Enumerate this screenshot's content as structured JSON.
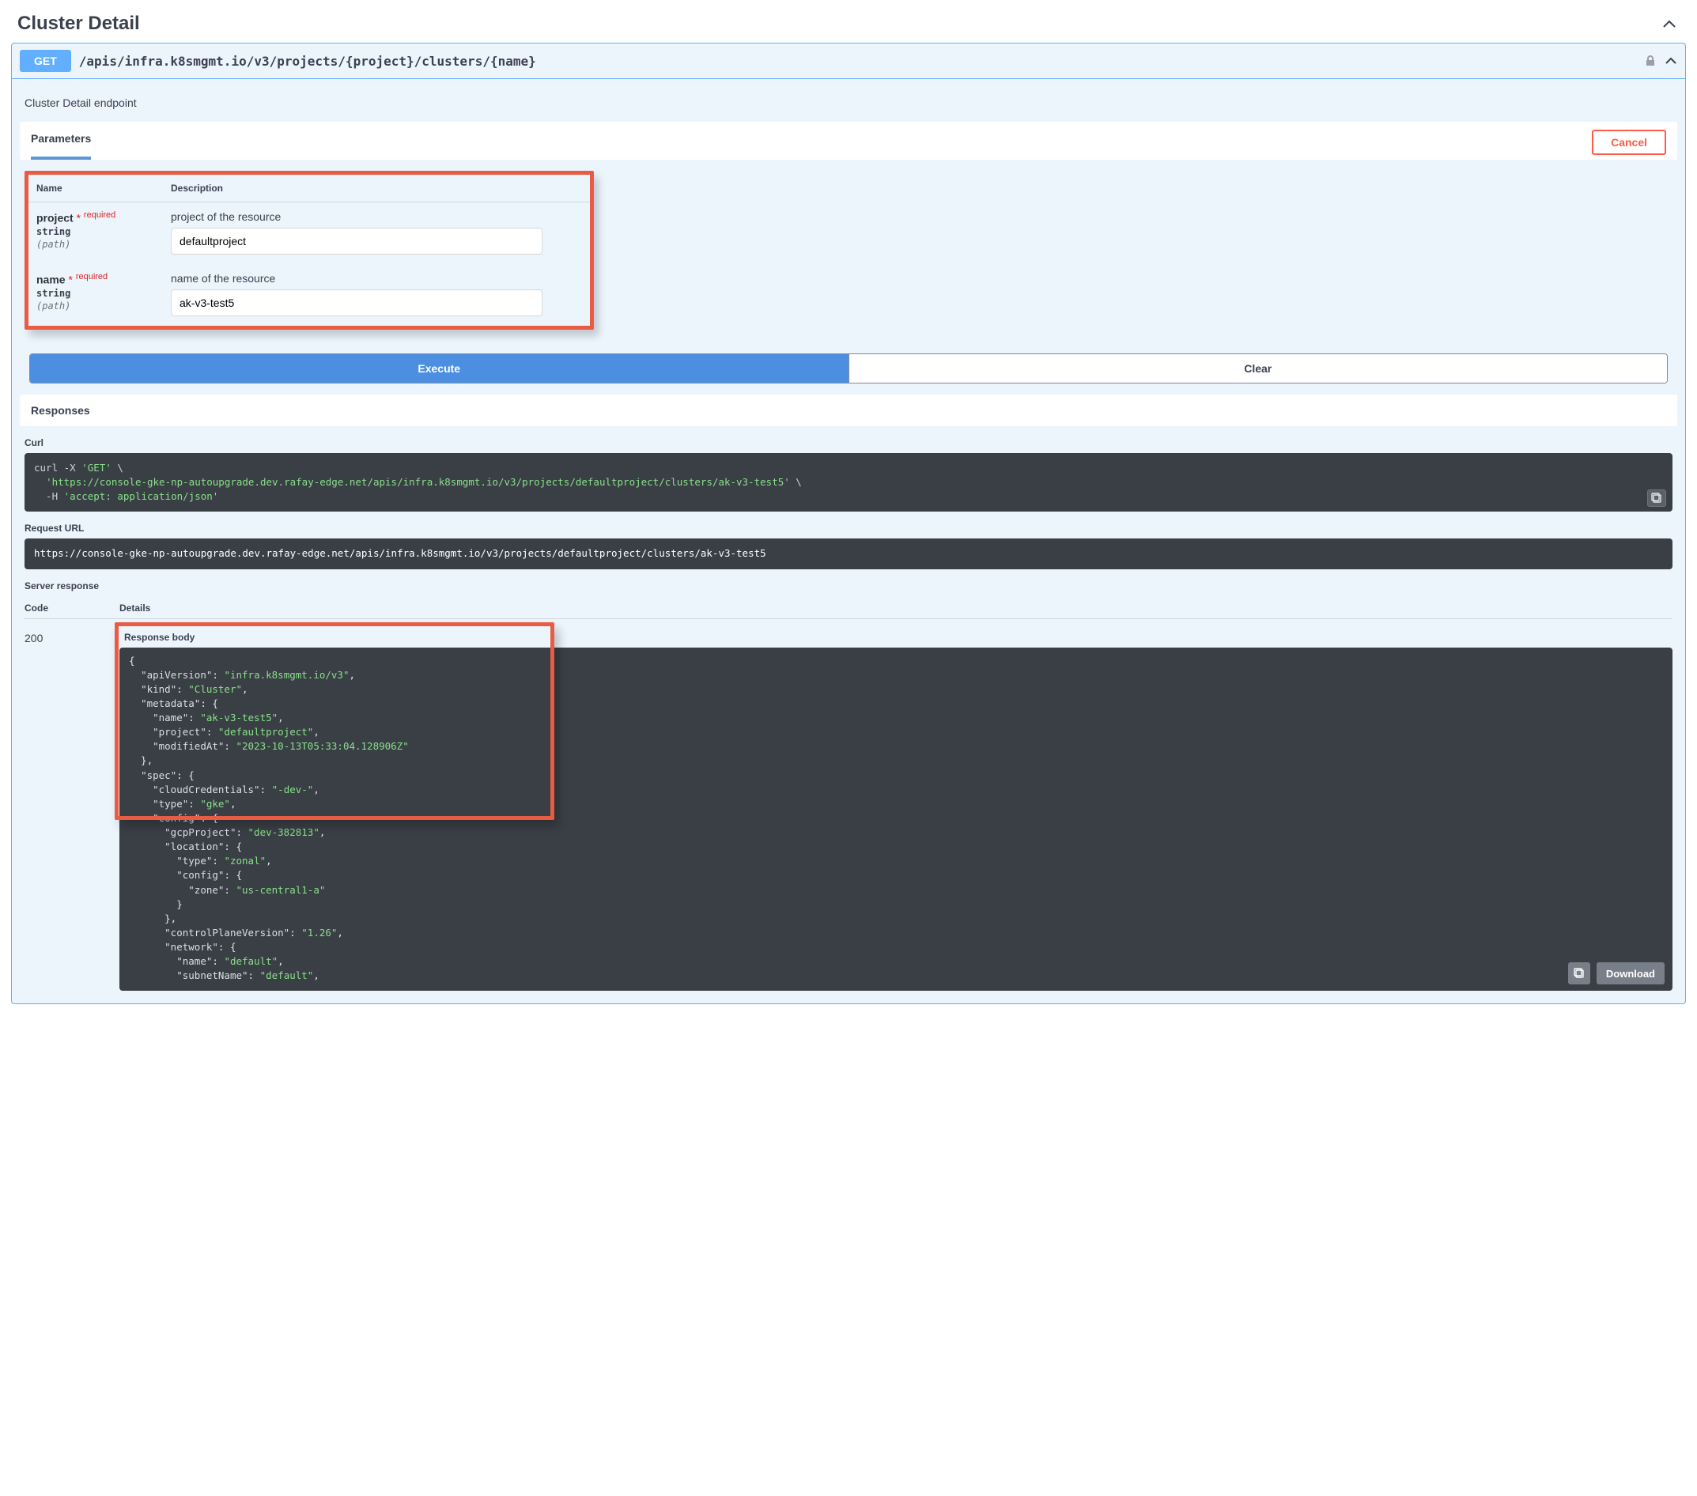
{
  "section": {
    "title": "Cluster Detail"
  },
  "op": {
    "method": "GET",
    "path": "/apis/infra.k8smgmt.io/v3/projects/{project}/clusters/{name}",
    "description": "Cluster Detail endpoint"
  },
  "tabs": {
    "parameters": "Parameters",
    "cancel": "Cancel"
  },
  "param_headers": {
    "name": "Name",
    "description": "Description"
  },
  "params": {
    "project": {
      "name": "project",
      "required_label": "required",
      "type": "string",
      "location": "(path)",
      "description": "project of the resource",
      "value": "defaultproject"
    },
    "name": {
      "name": "name",
      "required_label": "required",
      "type": "string",
      "location": "(path)",
      "description": "name of the resource",
      "value": "ak-v3-test5"
    }
  },
  "buttons": {
    "execute": "Execute",
    "clear": "Clear",
    "download": "Download"
  },
  "responses_label": "Responses",
  "curl_label": "Curl",
  "curl": {
    "l1a": "curl -X ",
    "l1b": "'GET'",
    "l1c": " \\",
    "l2a": "  ",
    "l2b": "'https://console-gke-np-autoupgrade.dev.rafay-edge.net/apis/infra.k8smgmt.io/v3/projects/defaultproject/clusters/ak-v3-test5'",
    "l2c": " \\",
    "l3a": "  -H ",
    "l3b": "'accept: application/json'"
  },
  "request_url_label": "Request URL",
  "request_url": "https://console-gke-np-autoupgrade.dev.rafay-edge.net/apis/infra.k8smgmt.io/v3/projects/defaultproject/clusters/ak-v3-test5",
  "server_response_label": "Server response",
  "cols": {
    "code": "Code",
    "details": "Details"
  },
  "status_code": "200",
  "body_label": "Response body",
  "response_body": {
    "apiVersion": "infra.k8smgmt.io/v3",
    "kind": "Cluster",
    "metadata": {
      "name": "ak-v3-test5",
      "project": "defaultproject",
      "modifiedAt": "2023-10-13T05:33:04.128906Z"
    },
    "spec": {
      "cloudCredentials": "-dev-",
      "type": "gke",
      "config": {
        "gcpProject": "dev-382813",
        "location": {
          "type": "zonal",
          "config": {
            "zone": "us-central1-a"
          }
        },
        "controlPlaneVersion": "1.26",
        "network": {
          "name": "default",
          "subnetName": "default"
        }
      }
    }
  }
}
